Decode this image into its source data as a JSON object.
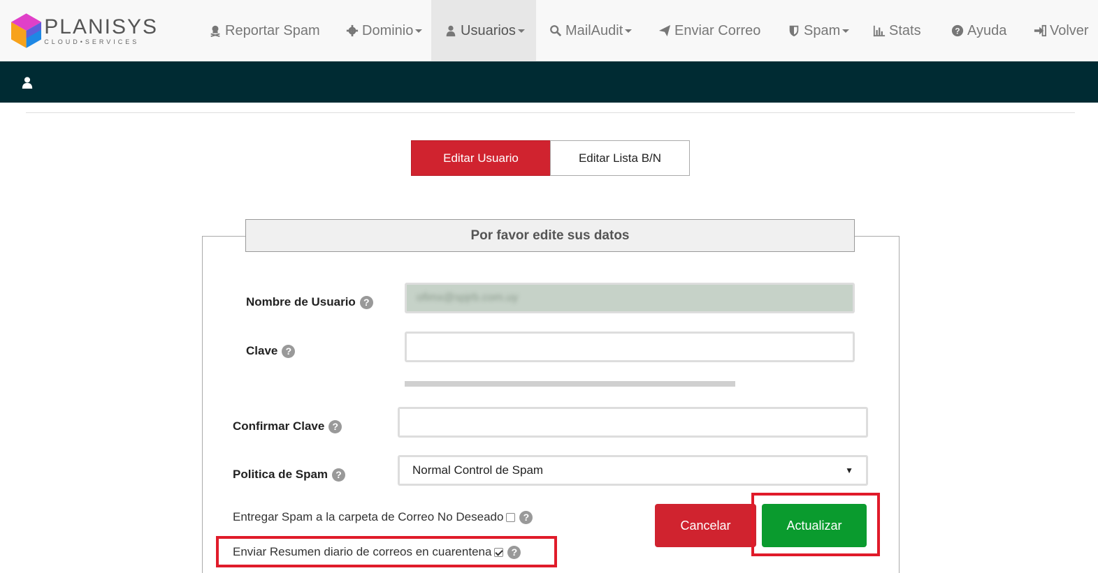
{
  "brand": {
    "name": "PLANISYS",
    "tagline": "CLOUD•SERVICES"
  },
  "nav": [
    {
      "id": "reportar-spam",
      "label": "Reportar Spam",
      "icon": "skull-icon",
      "dropdown": false,
      "active": false
    },
    {
      "id": "dominio",
      "label": "Dominio",
      "icon": "gear-icon",
      "dropdown": true,
      "active": false
    },
    {
      "id": "usuarios",
      "label": "Usuarios",
      "icon": "user-icon",
      "dropdown": true,
      "active": true
    },
    {
      "id": "mailaudit",
      "label": "MailAudit",
      "icon": "search-icon",
      "dropdown": true,
      "active": false
    },
    {
      "id": "enviar-correo",
      "label": "Enviar Correo",
      "icon": "send-icon",
      "dropdown": false,
      "active": false
    },
    {
      "id": "spam",
      "label": "Spam",
      "icon": "shield-icon",
      "dropdown": true,
      "active": false
    },
    {
      "id": "stats",
      "label": "Stats",
      "icon": "bar-chart-icon",
      "dropdown": false,
      "active": false
    },
    {
      "id": "ayuda",
      "label": "Ayuda",
      "icon": "question-icon",
      "dropdown": false,
      "active": false
    },
    {
      "id": "volver",
      "label": "Volver",
      "icon": "sign-in-icon",
      "dropdown": false,
      "active": false
    }
  ],
  "tabs": {
    "edit_user": "Editar Usuario",
    "edit_list": "Editar Lista B/N"
  },
  "form": {
    "legend": "Por favor edite sus datos",
    "username_label": "Nombre de Usuario",
    "username_value": "ofimx@spjrb.com.uy",
    "password_label": "Clave",
    "password_value": "",
    "confirm_label": "Confirmar Clave",
    "confirm_value": "",
    "policy_label": "Politica de Spam",
    "policy_value": "Normal Control de Spam",
    "junk_label": "Entregar Spam a la carpeta de Correo No Deseado",
    "junk_checked": false,
    "digest_label": "Enviar Resumen diario de correos en cuarentena",
    "digest_checked": true,
    "help_glyph": "?"
  },
  "buttons": {
    "cancel": "Cancelar",
    "update": "Actualizar"
  },
  "colors": {
    "accent_red": "#d0232f",
    "success_green": "#0a9b2e",
    "dark_bar": "#002b33",
    "highlight": "#e01b2a"
  }
}
